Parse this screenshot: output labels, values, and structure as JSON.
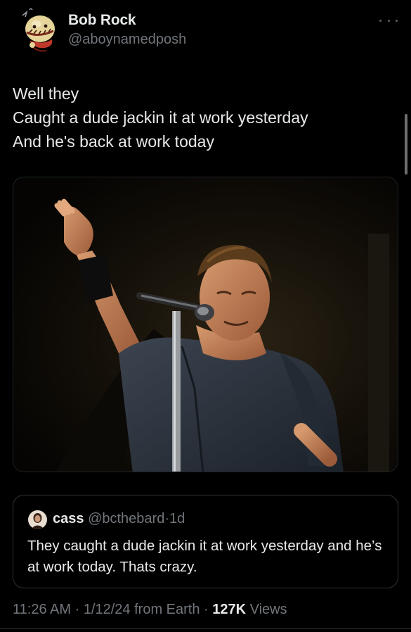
{
  "tweet": {
    "author": {
      "name": "Bob Rock",
      "handle": "@aboynamedposh",
      "avatar_icon": "cartoon-character-avatar"
    },
    "text_lines": [
      "Well they",
      "Caught a dude jackin it at work yesterday",
      "And he's back at work today"
    ],
    "media": {
      "icon": "photo-singer-at-microphone"
    },
    "more_icon": "more-horizontal-icon"
  },
  "quote": {
    "name": "cass",
    "handle": "@bcthebard",
    "separator": "·",
    "time": "1d",
    "text": "They caught a dude jackin it at work yesterday and he’s at work today. Thats crazy."
  },
  "meta": {
    "time": "11:26 AM",
    "sep1": " · ",
    "date": "1/12/24",
    "source": " from Earth",
    "sep2": " · ",
    "views_count": "127K",
    "views_label": " Views"
  },
  "colors": {
    "background": "#000000",
    "text_primary": "#e7e9ea",
    "text_secondary": "#71767b",
    "border": "#2f3336"
  }
}
